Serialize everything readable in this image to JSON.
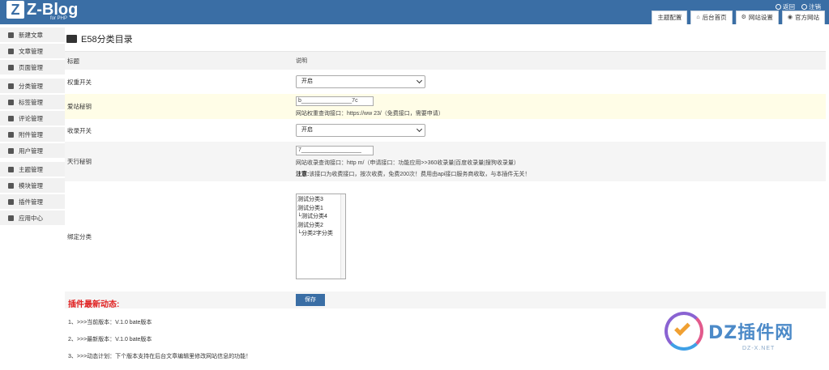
{
  "brand": {
    "logo_mark": "Z",
    "logo_text": "Z-Blog",
    "logo_sub": "for PHP"
  },
  "top_links": {
    "back": "返回",
    "logout": "注销"
  },
  "tabs": [
    {
      "label": "主题配置"
    },
    {
      "label": "后台首页",
      "icon": "home-icon"
    },
    {
      "label": "网站设置",
      "icon": "gear-icon"
    },
    {
      "label": "官方网站",
      "icon": "globe-icon"
    }
  ],
  "sidebar": {
    "items": [
      {
        "label": "新建文章"
      },
      {
        "label": "文章管理"
      },
      {
        "label": "页面管理"
      },
      {
        "label": "分类管理"
      },
      {
        "label": "标签管理"
      },
      {
        "label": "评论管理"
      },
      {
        "label": "附件管理"
      },
      {
        "label": "用户管理"
      },
      {
        "label": "主题管理"
      },
      {
        "label": "模块管理"
      },
      {
        "label": "插件管理"
      },
      {
        "label": "应用中心"
      }
    ]
  },
  "page": {
    "title": "E58分类目录"
  },
  "table": {
    "col_title": "标题",
    "col_desc": "说明",
    "rows": {
      "quanzhong": {
        "label": "权重开关",
        "value": "开启"
      },
      "aizhan": {
        "label": "爱站秘钥",
        "input": "b________________7c",
        "hint": "网站权重查询接口：https://ww                              23/（免费接口，需要申请）"
      },
      "shoulu": {
        "label": "收录开关",
        "value": "开启"
      },
      "tianxing": {
        "label": "天行秘钥",
        "input": "7___________________",
        "hint": "网站收录查询接口：http                      m/（申请接口：功能应用>>360收录量|百度收录量|搜狗收录量）",
        "note_label": "注意:",
        "note": "该接口为收费接口，按次收费，免费200次！费用由api接口服务商收取，与本插件无关！"
      },
      "bind": {
        "label": "绑定分类",
        "options": [
          "测试分类3",
          "测试分类1",
          "└测试分类4",
          "测试分类2",
          "└分类2字分类"
        ]
      }
    },
    "save_label": "保存"
  },
  "news": {
    "title": "插件最新动态:",
    "items": [
      "1、>>>当前版本：V.1.0 bate版本",
      "2、>>>最新版本：V.1.0 bate版本",
      "3、>>>动态计划：下个版本支持在后台文章编辑里修改网站信息的功能！"
    ]
  },
  "watermark": {
    "text": "DZ插件网",
    "sub": "DZ-X.NET"
  },
  "colors": {
    "header": "#3a6ea5",
    "highlight_row": "#fffde7",
    "news_title": "#e02020",
    "button": "#3a6ea5"
  }
}
